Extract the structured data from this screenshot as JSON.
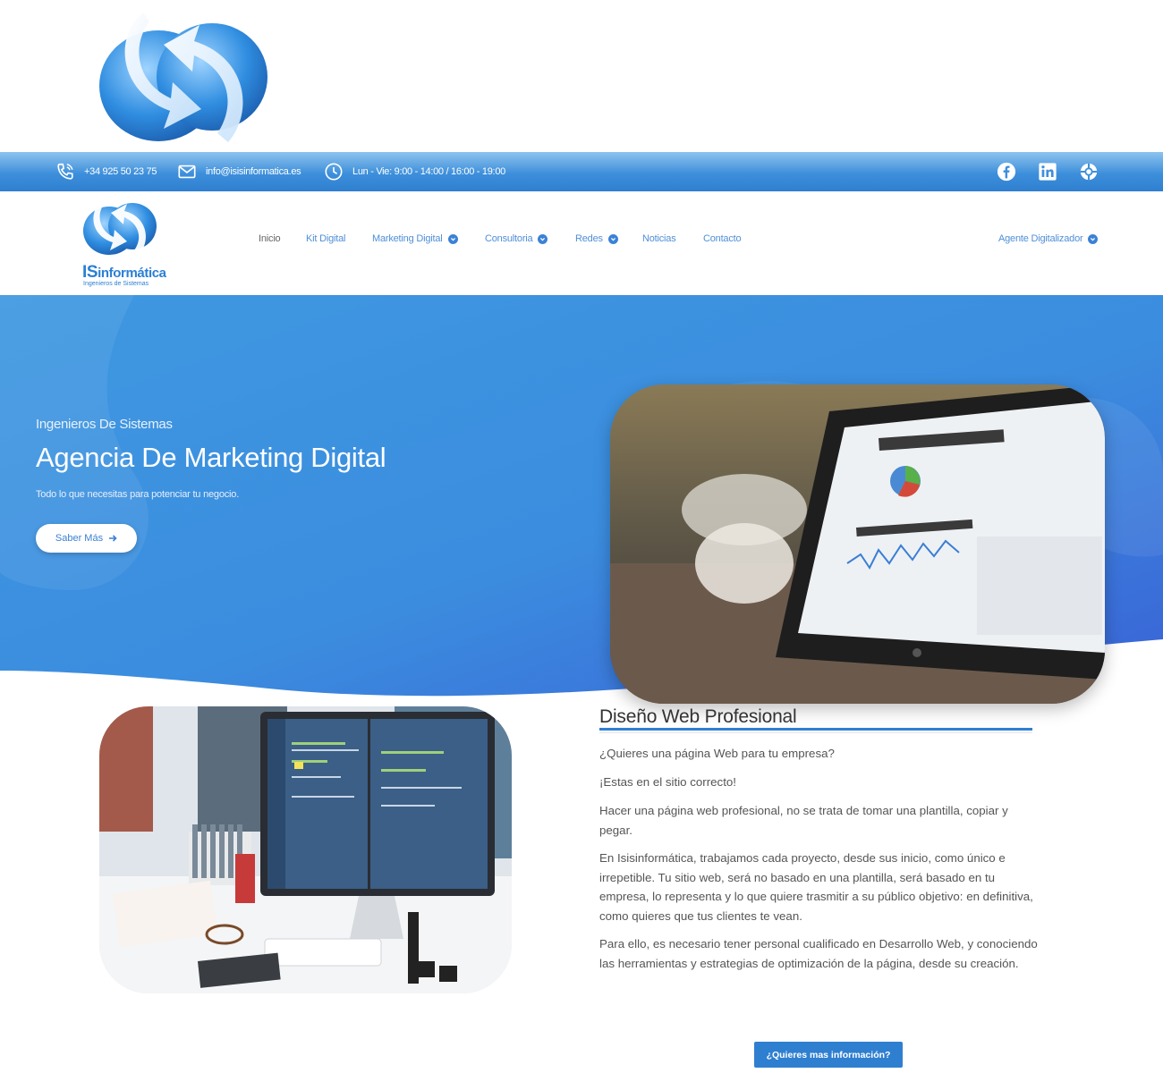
{
  "topbar": {
    "phone": "+34 925 50 23 75",
    "email": "info@isisinformatica.es",
    "hours": "Lun - Vie: 9:00 - 14:00 / 16:00 - 19:00",
    "social": [
      "facebook-icon",
      "linkedin-icon",
      "dribbble-icon"
    ]
  },
  "logo": {
    "brand_prefix": "IS",
    "brand_suffix": "informática",
    "tagline": "Ingenieros de Sistemas"
  },
  "nav": {
    "items": [
      {
        "label": "Inicio",
        "dropdown": false,
        "active": true
      },
      {
        "label": "Kit Digital",
        "dropdown": false
      },
      {
        "label": "Marketing Digital",
        "dropdown": true
      },
      {
        "label": "Consultoria",
        "dropdown": true
      },
      {
        "label": "Redes",
        "dropdown": true
      },
      {
        "label": "Noticias",
        "dropdown": false
      },
      {
        "label": "Contacto",
        "dropdown": false
      }
    ],
    "right_item": {
      "label": "Agente Digitalizador",
      "dropdown": true
    }
  },
  "hero": {
    "kicker": "Ingenieros De Sistemas",
    "title": "Agencia De Marketing Digital",
    "subtitle": "Todo lo que necesitas para potenciar tu negocio.",
    "button": "Saber Más"
  },
  "section": {
    "title": "Diseño Web Profesional",
    "paragraphs": [
      "¿Quieres una página Web para tu empresa?",
      "¡Estas en el sitio correcto!",
      "Hacer una página web profesional, no se trata de tomar una plantilla, copiar y pegar.",
      "En Isisinformática, trabajamos cada proyecto, desde sus inicio, como único e irrepetible. Tu sitio web, será no basado en una plantilla, será basado en tu empresa, lo  representa y lo que quiere trasmitir a su público objetivo: en definitiva, como quieres que tus clientes te vean.",
      "Para ello, es necesario tener personal cualificado en Desarrollo Web,  y conociendo las herramientas y estrategias de optimización de la página, desde su creación."
    ],
    "cta": "¿Quieres mas información?"
  },
  "colors": {
    "brand_blue": "#2f7fd0",
    "hero_light": "#4a9be2",
    "hero_dark": "#3a66d6"
  }
}
